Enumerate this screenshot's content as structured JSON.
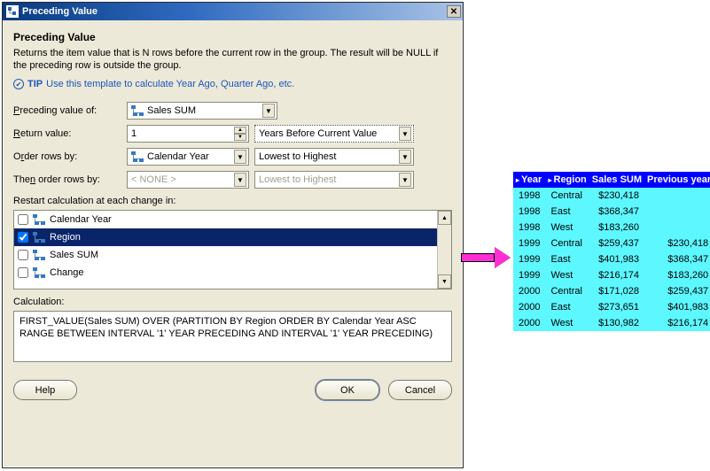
{
  "window": {
    "title": "Preceding Value",
    "heading": "Preceding Value",
    "description": "Returns the item value that is N rows before the current row in the group.  The result will be NULL if the preceding row is outside the group.",
    "tip_label": "TIP",
    "tip_text": "Use this template to calculate Year Ago, Quarter Ago, etc.",
    "labels": {
      "preceding_of": "Preceding value of:",
      "return_value": "Return value:",
      "order_rows": "Order rows by:",
      "then_order": "Then order rows by:",
      "restart": "Restart calculation at each change in:",
      "calculation": "Calculation:"
    },
    "fields": {
      "preceding_of": "Sales SUM",
      "return_value": "1",
      "return_unit": "Years Before Current Value",
      "order_rows_by": "Calendar Year",
      "order_dir1": "Lowest to Highest",
      "then_order_by": "< NONE >",
      "order_dir2": "Lowest to Highest"
    },
    "restart_items": [
      "Calendar Year",
      "Region",
      "Sales SUM",
      "Change"
    ],
    "restart_checked_index": 1,
    "calculation_text": "FIRST_VALUE(Sales SUM) OVER (PARTITION BY Region ORDER BY Calendar Year ASC RANGE BETWEEN INTERVAL '1' YEAR PRECEDING AND INTERVAL '1' YEAR PRECEDING)",
    "buttons": {
      "help": "Help",
      "ok": "OK",
      "cancel": "Cancel"
    }
  },
  "chart_data": {
    "type": "table",
    "columns": [
      "Year",
      "Region",
      "Sales SUM",
      "Previous year"
    ],
    "rows": [
      [
        "1998",
        "Central",
        "$230,418",
        ""
      ],
      [
        "1998",
        "East",
        "$368,347",
        ""
      ],
      [
        "1998",
        "West",
        "$183,260",
        ""
      ],
      [
        "1999",
        "Central",
        "$259,437",
        "$230,418"
      ],
      [
        "1999",
        "East",
        "$401,983",
        "$368,347"
      ],
      [
        "1999",
        "West",
        "$216,174",
        "$183,260"
      ],
      [
        "2000",
        "Central",
        "$171,028",
        "$259,437"
      ],
      [
        "2000",
        "East",
        "$273,651",
        "$401,983"
      ],
      [
        "2000",
        "West",
        "$130,982",
        "$216,174"
      ]
    ]
  }
}
